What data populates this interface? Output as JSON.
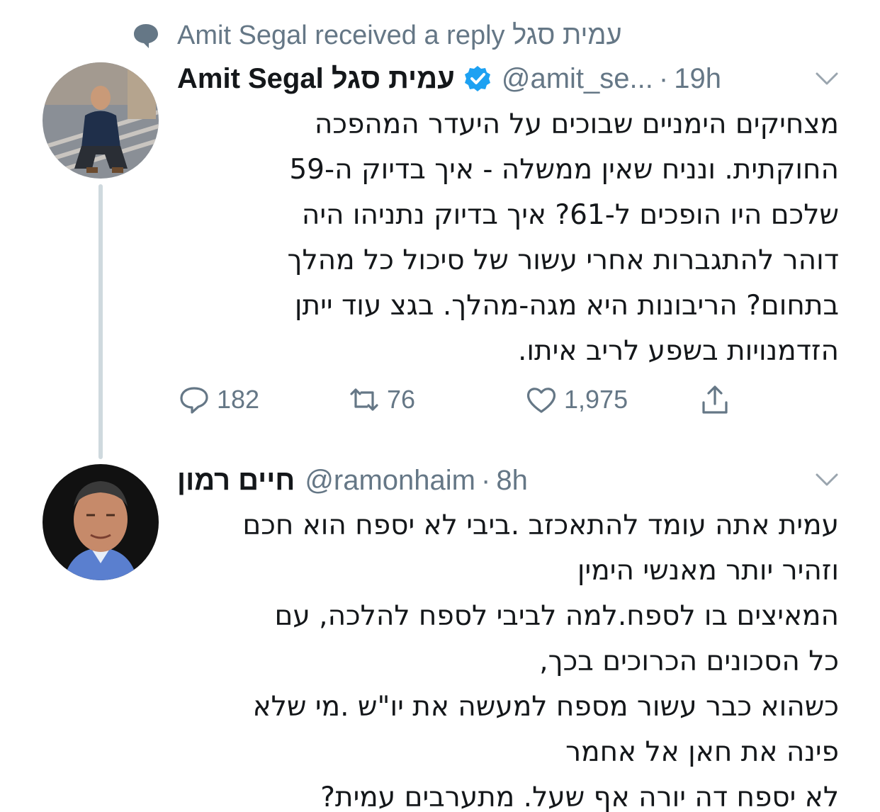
{
  "context": {
    "text": "Amit Segal received a reply עמית סגל",
    "icon": "speech-bubble-icon"
  },
  "tweet": {
    "display_name": "Amit Segal עמית סגל",
    "verified": true,
    "handle": "@amit_se...",
    "time": "19h",
    "lines": [
      "מצחיקים הימניים שבוכים על היעדר המהפכה",
      "החוקתית. ונניח שאין ממשלה - איך בדיוק ה-59",
      "שלכם היו הופכים ל-61? איך בדיוק נתניהו היה",
      "דוהר להתגברות אחרי עשור של סיכול כל מהלך",
      "בתחום? הריבונות היא מגה-מהלך. בגצ עוד ייתן",
      "הזדמנויות בשפע לריב איתו."
    ],
    "stats": {
      "replies": "182",
      "retweets": "76",
      "likes": "1,975"
    }
  },
  "reply": {
    "display_name": "חיים רמון",
    "handle": "@ramonhaim",
    "time": "8h",
    "lines": [
      "עמית אתה עומד להתאכזב .ביבי לא יספח הוא חכם",
      "וזהיר יותר מאנשי הימין",
      "המאיצים בו לספח.למה לביבי לספח להלכה, עם ",
      "כל הסכונים הכרוכים בכך,",
      "כשהוא כבר עשור מספח למעשה את יו\"ש .מי שלא",
      "פינה  את חאן אל אחמר",
      "לא יספח דה יורה אף שעל. מתערבים עמית?"
    ]
  },
  "colors": {
    "text_primary": "#14171a",
    "text_secondary": "#657786",
    "verified_blue": "#1da1f2",
    "thread_line": "#cfd9de"
  }
}
